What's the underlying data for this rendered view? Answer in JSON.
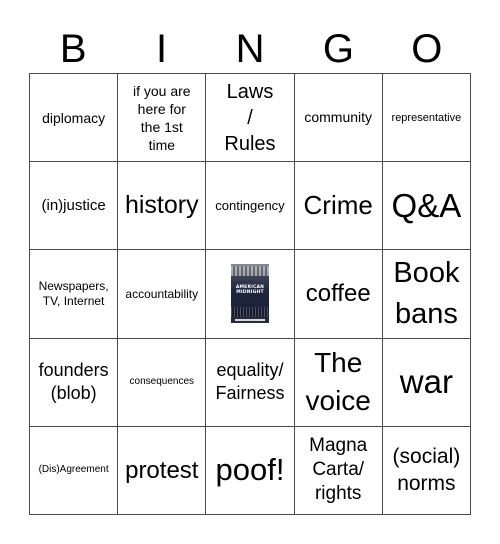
{
  "header": {
    "letters": [
      "B",
      "I",
      "N",
      "G",
      "O"
    ]
  },
  "card": {
    "rows": [
      [
        "diplomacy",
        "if you are here for the 1st time",
        "Laws / Rules",
        "community",
        "representative"
      ],
      [
        "(in)justice",
        "history",
        "contingency",
        "Crime",
        "Q&A"
      ],
      [
        "Newspapers, TV, Internet",
        "accountability",
        "American Midnight book cover",
        "coffee",
        "Book bans"
      ],
      [
        "founders (blob)",
        "consequences",
        "equality/ Fairness",
        "The voice",
        "war"
      ],
      [
        "(Dis)Agreement",
        "protest",
        "poof!",
        "Magna Carta/ rights",
        "(social) norms"
      ]
    ],
    "center_image": {
      "title": "AMERICAN MIDNIGHT",
      "icon": "book-cover-image"
    }
  }
}
